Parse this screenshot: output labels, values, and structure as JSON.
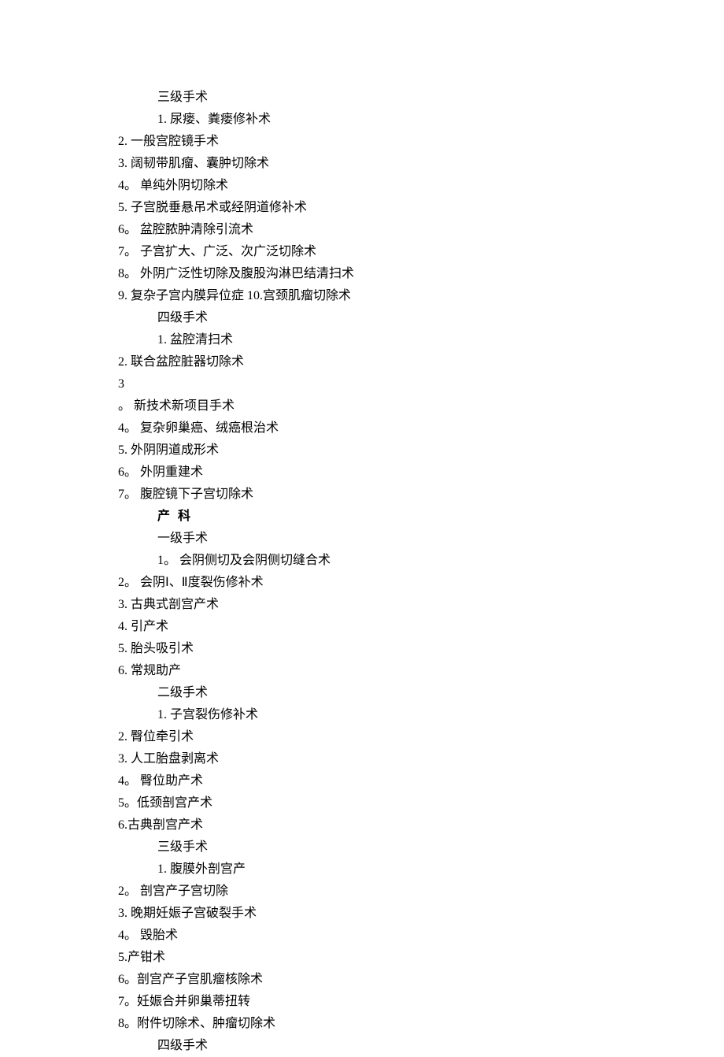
{
  "lines": [
    {
      "indent": 1,
      "bold": false,
      "text": "三级手术"
    },
    {
      "indent": 1,
      "bold": false,
      "text": "1. 尿瘘、粪瘘修补术"
    },
    {
      "indent": 0,
      "bold": false,
      "text": "2. 一般宫腔镜手术"
    },
    {
      "indent": 0,
      "bold": false,
      "text": "3. 阔韧带肌瘤、囊肿切除术"
    },
    {
      "indent": 0,
      "bold": false,
      "text": "4。 单纯外阴切除术"
    },
    {
      "indent": 0,
      "bold": false,
      "text": "5. 子宫脱垂悬吊术或经阴道修补术"
    },
    {
      "indent": 0,
      "bold": false,
      "text": "6。 盆腔脓肿清除引流术"
    },
    {
      "indent": 0,
      "bold": false,
      "text": "7。 子宫扩大、广泛、次广泛切除术"
    },
    {
      "indent": 0,
      "bold": false,
      "text": "8。 外阴广泛性切除及腹股沟淋巴结清扫术"
    },
    {
      "indent": 0,
      "bold": false,
      "text": "9. 复杂子宫内膜异位症 10.宫颈肌瘤切除术"
    },
    {
      "indent": 1,
      "bold": false,
      "text": "四级手术"
    },
    {
      "indent": 1,
      "bold": false,
      "text": "1. 盆腔清扫术"
    },
    {
      "indent": 0,
      "bold": false,
      "text": "2. 联合盆腔脏器切除术"
    },
    {
      "indent": 0,
      "bold": false,
      "text": "3"
    },
    {
      "indent": 0,
      "bold": false,
      "text": "。 新技术新项目手术"
    },
    {
      "indent": 0,
      "bold": false,
      "text": "4。 复杂卵巢癌、绒癌根治术"
    },
    {
      "indent": 0,
      "bold": false,
      "text": "5. 外阴阴道成形术"
    },
    {
      "indent": 0,
      "bold": false,
      "text": "6。 外阴重建术"
    },
    {
      "indent": 0,
      "bold": false,
      "text": "7。 腹腔镜下子宫切除术"
    },
    {
      "indent": 1,
      "bold": true,
      "text": "产 科"
    },
    {
      "indent": 1,
      "bold": false,
      "text": "一级手术"
    },
    {
      "indent": 1,
      "bold": false,
      "text": "1。 会阴侧切及会阴侧切缝合术"
    },
    {
      "indent": 0,
      "bold": false,
      "text": "2。 会阴Ⅰ、Ⅱ度裂伤修补术"
    },
    {
      "indent": 0,
      "bold": false,
      "text": "3. 古典式剖宫产术"
    },
    {
      "indent": 0,
      "bold": false,
      "text": "4. 引产术"
    },
    {
      "indent": 0,
      "bold": false,
      "text": "5. 胎头吸引术"
    },
    {
      "indent": 0,
      "bold": false,
      "text": "6. 常规助产"
    },
    {
      "indent": 1,
      "bold": false,
      "text": "二级手术"
    },
    {
      "indent": 1,
      "bold": false,
      "text": "1. 子宫裂伤修补术"
    },
    {
      "indent": 0,
      "bold": false,
      "text": "2. 臀位牵引术"
    },
    {
      "indent": 0,
      "bold": false,
      "text": "3. 人工胎盘剥离术"
    },
    {
      "indent": 0,
      "bold": false,
      "text": "4。 臀位助产术"
    },
    {
      "indent": 0,
      "bold": false,
      "text": "5。低颈剖宫产术"
    },
    {
      "indent": 0,
      "bold": false,
      "text": "6.古典剖宫产术"
    },
    {
      "indent": 1,
      "bold": false,
      "text": "三级手术"
    },
    {
      "indent": 1,
      "bold": false,
      "text": "1. 腹膜外剖宫产"
    },
    {
      "indent": 0,
      "bold": false,
      "text": "2。 剖宫产子宫切除"
    },
    {
      "indent": 0,
      "bold": false,
      "text": "3. 晚期妊娠子宫破裂手术"
    },
    {
      "indent": 0,
      "bold": false,
      "text": "4。 毁胎术"
    },
    {
      "indent": 0,
      "bold": false,
      "text": "5.产钳术"
    },
    {
      "indent": 0,
      "bold": false,
      "text": "6。剖宫产子宫肌瘤核除术"
    },
    {
      "indent": 0,
      "bold": false,
      "text": "7。妊娠合并卵巢蒂扭转"
    },
    {
      "indent": 0,
      "bold": false,
      "text": "8。附件切除术、肿瘤切除术"
    },
    {
      "indent": 1,
      "bold": false,
      "text": "四级手术"
    }
  ]
}
